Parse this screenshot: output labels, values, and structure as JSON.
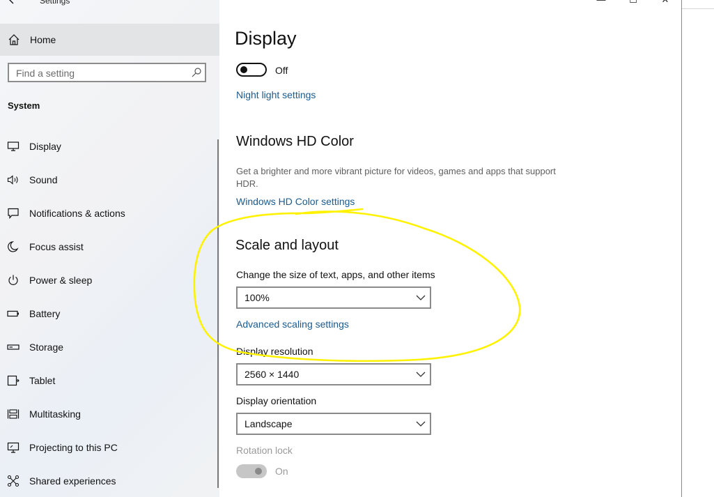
{
  "window": {
    "title": "Settings",
    "back_icon": "arrow-left-icon",
    "minimize_glyph": "—",
    "maximize_glyph": "☐",
    "close_glyph": "✕"
  },
  "sidebar": {
    "home_label": "Home",
    "search_placeholder": "Find a setting",
    "section_title": "System",
    "items": [
      {
        "label": "Display",
        "icon": "monitor-icon"
      },
      {
        "label": "Sound",
        "icon": "speaker-icon"
      },
      {
        "label": "Notifications & actions",
        "icon": "message-icon"
      },
      {
        "label": "Focus assist",
        "icon": "moon-icon"
      },
      {
        "label": "Power & sleep",
        "icon": "power-icon"
      },
      {
        "label": "Battery",
        "icon": "battery-icon"
      },
      {
        "label": "Storage",
        "icon": "storage-icon"
      },
      {
        "label": "Tablet",
        "icon": "tablet-icon"
      },
      {
        "label": "Multitasking",
        "icon": "multitasking-icon"
      },
      {
        "label": "Projecting to this PC",
        "icon": "projector-icon"
      },
      {
        "label": "Shared experiences",
        "icon": "shared-icon"
      }
    ]
  },
  "main": {
    "title": "Display",
    "night_light": {
      "state_label": "Off",
      "link": "Night light settings"
    },
    "hd_color": {
      "heading": "Windows HD Color",
      "description": "Get a brighter and more vibrant picture for videos, games and apps that support HDR.",
      "link": "Windows HD Color settings"
    },
    "scale_layout": {
      "heading": "Scale and layout",
      "scale_label": "Change the size of text, apps, and other items",
      "scale_value": "100%",
      "advanced_link": "Advanced scaling settings",
      "resolution_label": "Display resolution",
      "resolution_value": "2560 × 1440",
      "orientation_label": "Display orientation",
      "orientation_value": "Landscape",
      "rotation_lock_label": "Rotation lock",
      "rotation_lock_state": "On"
    }
  },
  "colors": {
    "accent_link": "#1a5a8f",
    "annotation": "#fff200",
    "sidebar_selected": "#e2e4e6"
  }
}
